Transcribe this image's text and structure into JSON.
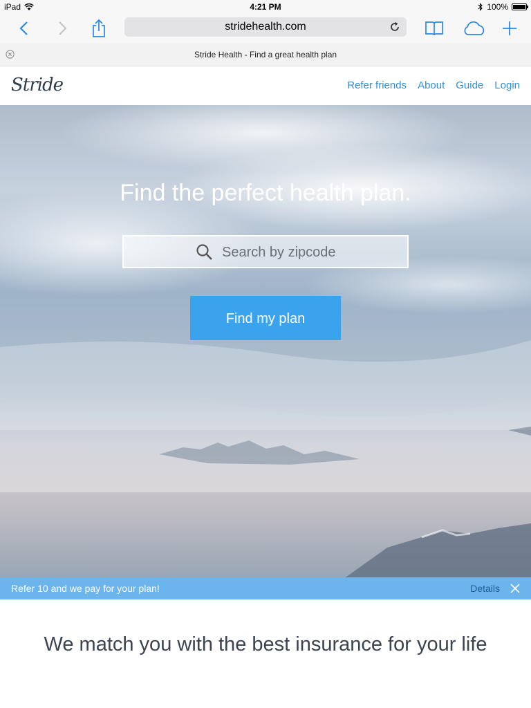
{
  "status_bar": {
    "device": "iPad",
    "time": "4:21 PM",
    "battery": "100%",
    "battery_level": 1.0
  },
  "browser": {
    "url": "stridehealth.com",
    "tab_title": "Stride Health - Find a great health plan",
    "icons": [
      "back-icon",
      "forward-icon",
      "share-icon",
      "reload-icon",
      "bookmarks-icon",
      "cloud-tabs-icon",
      "new-tab-icon",
      "tab-close-icon"
    ]
  },
  "site": {
    "logo": "Stride",
    "nav": [
      {
        "label": "Refer friends"
      },
      {
        "label": "About"
      },
      {
        "label": "Guide"
      },
      {
        "label": "Login"
      }
    ]
  },
  "hero": {
    "title": "Find the perfect health plan.",
    "search_placeholder": "Search by zipcode",
    "cta_label": "Find my plan"
  },
  "banner": {
    "message": "Refer 10 and we pay for your plan!",
    "details_label": "Details"
  },
  "tagline": "We match you with the best insurance for your life",
  "colors": {
    "accent": "#3aa3ee",
    "link": "#2f8fd8",
    "banner": "#6cb4ec"
  }
}
